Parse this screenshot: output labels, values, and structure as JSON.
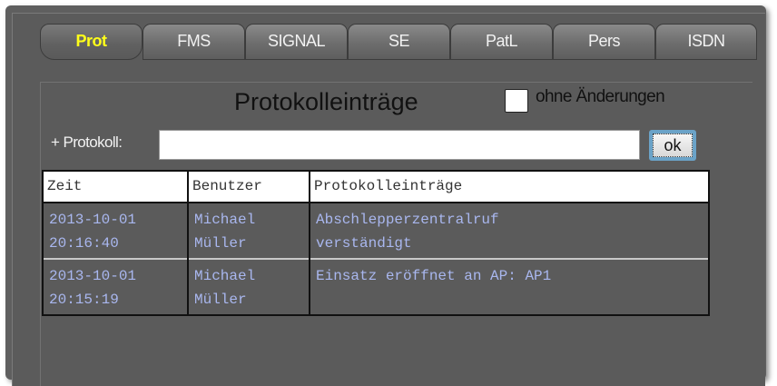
{
  "tabs": [
    {
      "label": "Prot",
      "active": true
    },
    {
      "label": "FMS"
    },
    {
      "label": "SIGNAL"
    },
    {
      "label": "SE"
    },
    {
      "label": "PatL"
    },
    {
      "label": "Pers"
    },
    {
      "label": "ISDN"
    }
  ],
  "panel": {
    "title": "Protokolleinträge",
    "checkbox_label": "ohne Änderungen",
    "checkbox_checked": false,
    "protocol_label": "+ Protokoll:",
    "protocol_value": "",
    "ok_label": "ok"
  },
  "table": {
    "columns": [
      "Zeit",
      "Benutzer",
      "Protokolleinträge"
    ],
    "rows": [
      {
        "zeit": [
          "2013-10-01",
          "20:16:40"
        ],
        "benutzer": [
          "Michael",
          "Müller"
        ],
        "eintrag": [
          "Abschlepperzentralruf",
          "verständigt"
        ]
      },
      {
        "zeit": [
          "2013-10-01",
          "20:15:19"
        ],
        "benutzer": [
          "Michael",
          "Müller"
        ],
        "eintrag": [
          "Einsatz eröffnet an AP: AP1",
          ""
        ]
      }
    ]
  },
  "colors": {
    "active_tab_text": "#ffff1a",
    "cell_text": "#a9b7ef",
    "background": "#5b5b5b"
  }
}
